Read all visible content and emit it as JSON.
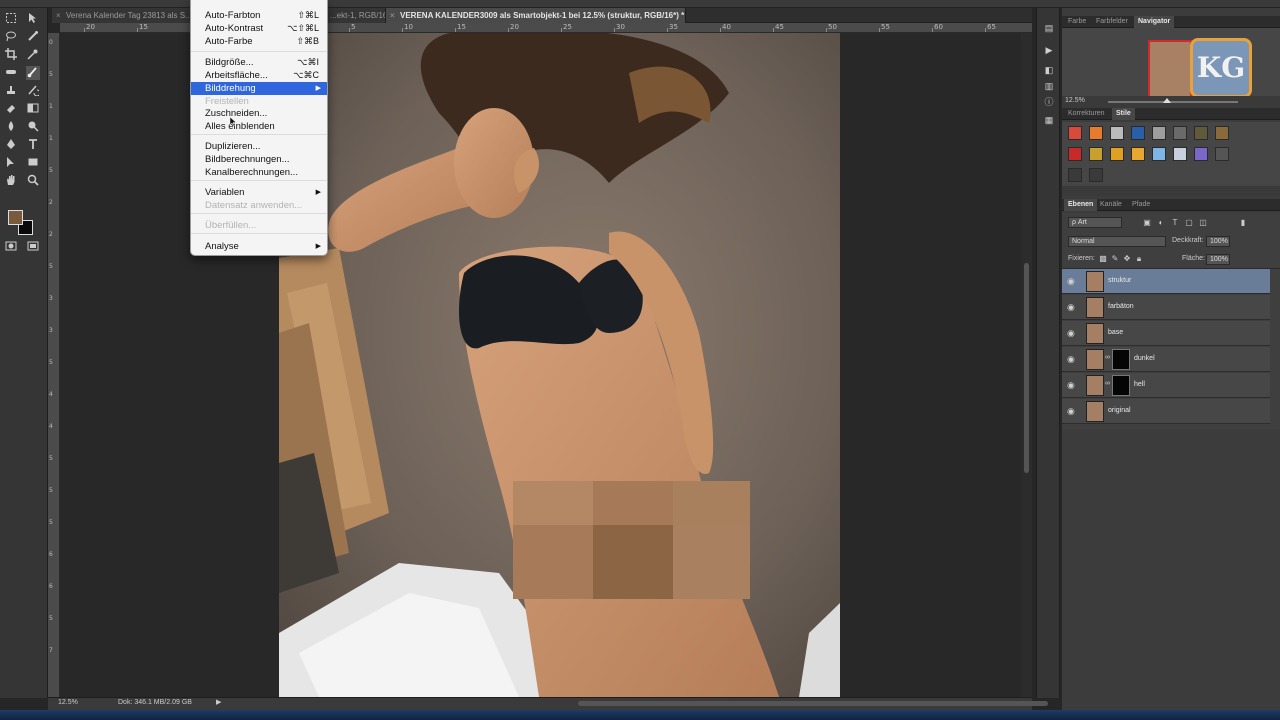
{
  "tabs": [
    {
      "label": "Verena Kalender Tag 23813 als S...",
      "close": "×",
      "active": false
    },
    {
      "label": "...ekt-1, RGB/16*) *",
      "close": "",
      "active": false
    },
    {
      "label": "VERENA KALENDER3009 als Smartobjekt-1 bei 12.5% (struktur, RGB/16*) *",
      "close": "×",
      "active": true
    }
  ],
  "ruler_top": [
    "20",
    "15",
    "10",
    "5",
    "0",
    "5",
    "10",
    "15",
    "20",
    "25",
    "30",
    "35",
    "40",
    "45",
    "50",
    "55",
    "60",
    "65",
    "70"
  ],
  "ruler_left": [
    "0",
    "5",
    "1",
    "1",
    "5",
    "2",
    "2",
    "5",
    "3",
    "3",
    "5",
    "4",
    "4",
    "5",
    "5",
    "5",
    "6",
    "6",
    "5",
    "7"
  ],
  "status": {
    "zoom": "12.5%",
    "doc": "Dok: 346.1 MB/2.09 GB",
    "arrow": "▶"
  },
  "menu": [
    {
      "label": "Auto-Farbton",
      "shortcut": "⇧⌘L",
      "state": "normal",
      "submenu": false
    },
    {
      "label": "Auto-Kontrast",
      "shortcut": "⌥⇧⌘L",
      "state": "normal",
      "submenu": false
    },
    {
      "label": "Auto-Farbe",
      "shortcut": "⇧⌘B",
      "state": "normal",
      "submenu": false
    },
    {
      "label": "Bildgröße...",
      "shortcut": "⌥⌘I",
      "state": "normal",
      "submenu": false
    },
    {
      "label": "Arbeitsfläche...",
      "shortcut": "⌥⌘C",
      "state": "normal",
      "submenu": false
    },
    {
      "label": "Bilddrehung",
      "shortcut": "",
      "state": "highlighted",
      "submenu": true
    },
    {
      "label": "Freistellen",
      "shortcut": "",
      "state": "disabled",
      "submenu": false
    },
    {
      "label": "Zuschneiden...",
      "shortcut": "",
      "state": "normal",
      "submenu": false
    },
    {
      "label": "Alles einblenden",
      "shortcut": "",
      "state": "normal",
      "submenu": false
    },
    {
      "label": "Duplizieren...",
      "shortcut": "",
      "state": "normal",
      "submenu": false
    },
    {
      "label": "Bildberechnungen...",
      "shortcut": "",
      "state": "normal",
      "submenu": false
    },
    {
      "label": "Kanalberechnungen...",
      "shortcut": "",
      "state": "normal",
      "submenu": false
    },
    {
      "label": "Variablen",
      "shortcut": "",
      "state": "normal",
      "submenu": true
    },
    {
      "label": "Datensatz anwenden...",
      "shortcut": "",
      "state": "disabled",
      "submenu": false
    },
    {
      "label": "Überfüllen...",
      "shortcut": "",
      "state": "disabled",
      "submenu": false
    },
    {
      "label": "Analyse",
      "shortcut": "",
      "state": "normal",
      "submenu": true
    }
  ],
  "panels": {
    "top_tabs": [
      "Farbe",
      "Farbfelder",
      "Navigator"
    ],
    "navigator": {
      "zoom": "12.5%",
      "zoom_fraction": 0.45,
      "logo_text": "KG"
    },
    "mid_tabs": [
      "Korrekturen",
      "Stile"
    ],
    "layer_tabs": [
      "Ebenen",
      "Kanäle",
      "Pfade"
    ],
    "filter": "ρ Art",
    "blend_mode": "Normal",
    "opacity_label": "Deckkraft:",
    "opacity": "100%",
    "lock_label": "Fixieren:",
    "fill_label": "Fläche:",
    "fill": "100%",
    "layers": [
      {
        "name": "struktur",
        "selected": true,
        "mask": false
      },
      {
        "name": "farbäton",
        "selected": false,
        "mask": false
      },
      {
        "name": "base",
        "selected": false,
        "mask": false
      },
      {
        "name": "dunkel",
        "selected": false,
        "mask": true
      },
      {
        "name": "hell",
        "selected": false,
        "mask": true
      },
      {
        "name": "original",
        "selected": false,
        "mask": false
      }
    ]
  },
  "style_swatches": [
    "#d94a3a",
    "#e87a2e",
    "#bbbbbb",
    "#2b5ea8",
    "#9e9e9e",
    "#6a6a6a",
    "#5e5a3a",
    "#8a6a3a",
    "#c82a2a",
    "#c8a030",
    "#e0a020",
    "#e8a830",
    "#7eb7e6",
    "#c8d0e0",
    "#7a68c8",
    "#555555"
  ],
  "colors": {
    "foreground": "#7a5a3c",
    "background": "#0a0a0a",
    "menu_highlight": "#2f66dd",
    "selected_layer": "#6a7d98"
  }
}
